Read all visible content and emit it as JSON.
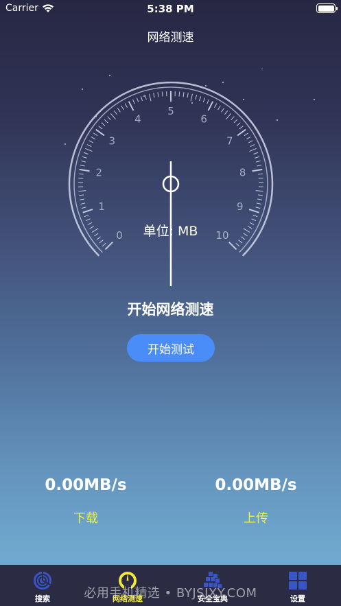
{
  "status_bar": {
    "carrier": "Carrier",
    "time": "5:38 PM"
  },
  "nav": {
    "title": "网络测速"
  },
  "gauge": {
    "scale": [
      "0",
      "1",
      "2",
      "3",
      "4",
      "5",
      "6",
      "7",
      "8",
      "9",
      "10"
    ],
    "unit": "单位: MB",
    "needle_value": 5
  },
  "main": {
    "heading": "开始网络测速",
    "start_button": "开始测试"
  },
  "stats": {
    "download": {
      "value": "0.00MB/s",
      "label": "下载"
    },
    "upload": {
      "value": "0.00MB/s",
      "label": "上传"
    }
  },
  "tabbar": {
    "tabs": [
      {
        "label": "搜索",
        "icon": "radar-icon"
      },
      {
        "label": "网络测速",
        "icon": "speedometer-icon"
      },
      {
        "label": "安全宝典",
        "icon": "blocks-icon"
      },
      {
        "label": "设置",
        "icon": "grid-icon"
      }
    ],
    "active_index": 1
  },
  "watermark": "必用手机精选 • BYJSJXY.COM",
  "colors": {
    "accent": "#4b8df8",
    "label_yellow": "#ecf04a",
    "tab_active": "#f1e83a",
    "tab_icon": "#3a55c8"
  }
}
